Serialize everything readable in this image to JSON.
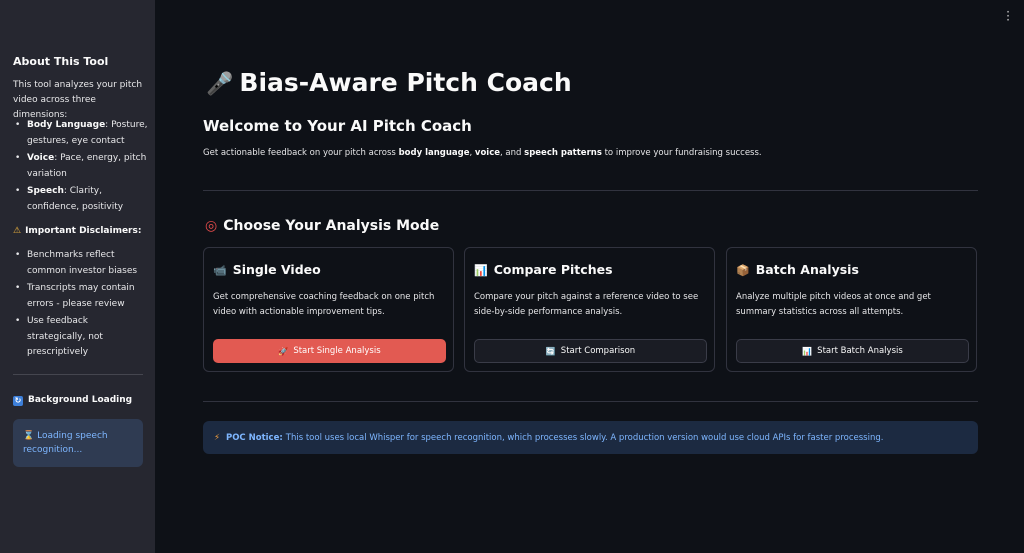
{
  "sidebar": {
    "title": "About This Tool",
    "intro": "This tool analyzes your pitch video across three dimensions:",
    "dimensions": [
      {
        "label": "Body Language",
        "text": ": Posture, gestures, eye contact"
      },
      {
        "label": "Voice",
        "text": ": Pace, energy, pitch variation"
      },
      {
        "label": "Speech",
        "text": ": Clarity, confidence, positivity"
      }
    ],
    "disclaimer_title": "Important Disclaimers:",
    "disclaimers": [
      "Benchmarks reflect common investor biases",
      "Transcripts may contain errors - please review",
      "Use feedback strategically, not prescriptively"
    ],
    "background_title": "Background Loading",
    "loading_text": "Loading speech recognition..."
  },
  "header": {
    "title": "Bias-Aware Pitch Coach",
    "welcome": "Welcome to Your AI Pitch Coach",
    "desc_pre": "Get actionable feedback on your pitch across ",
    "desc_b1": "body language",
    "desc_sep1": ", ",
    "desc_b2": "voice",
    "desc_sep2": ", and ",
    "desc_b3": "speech patterns",
    "desc_post": " to improve your fundraising success."
  },
  "modes": {
    "heading": "Choose Your Analysis Mode",
    "cards": [
      {
        "title": "Single Video",
        "description": "Get comprehensive coaching feedback on one pitch video with actionable improvement tips.",
        "button": "Start Single Analysis"
      },
      {
        "title": "Compare Pitches",
        "description": "Compare your pitch against a reference video to see side-by-side performance analysis.",
        "button": "Start Comparison"
      },
      {
        "title": "Batch Analysis",
        "description": "Analyze multiple pitch videos at once and get summary statistics across all attempts.",
        "button": "Start Batch Analysis"
      }
    ]
  },
  "notice": {
    "label": "POC Notice:",
    "text": "This tool uses local Whisper for speech recognition, which processes slowly. A production version would use cloud APIs for faster processing."
  },
  "colors": {
    "background": "#0e1117",
    "sidebar": "#262730",
    "primary_button": "#e25a52",
    "info_text": "#7eb6ff"
  }
}
